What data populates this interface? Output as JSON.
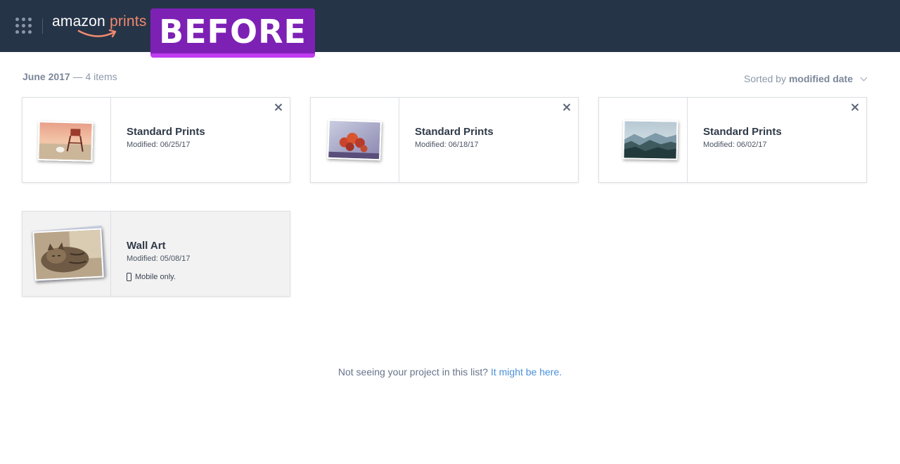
{
  "header": {
    "logo_primary": "amazon",
    "logo_secondary": "prints",
    "badge": "BEFORE",
    "colors": {
      "bar": "#263448",
      "logo_accent": "#f08a6e",
      "badge": "#7d21b5"
    }
  },
  "group": {
    "date": "June 2017",
    "count": "— 4 items"
  },
  "sort": {
    "prefix": "Sorted by",
    "value": "modified date"
  },
  "projects": [
    {
      "title": "Standard Prints",
      "modified": "Modified: 06/25/17",
      "thumbnail": "beach-lifeguard-photo"
    },
    {
      "title": "Standard Prints",
      "modified": "Modified: 06/18/17",
      "thumbnail": "red-flowers-photo"
    },
    {
      "title": "Standard Prints",
      "modified": "Modified: 06/02/17",
      "thumbnail": "misty-mountains-photo"
    },
    {
      "title": "Wall Art",
      "modified": "Modified: 05/08/17",
      "note": "Mobile only.",
      "thumbnail": "sleeping-cat-photo"
    }
  ],
  "footer": {
    "text": "Not seeing your project in this list?",
    "link": "It might be here."
  }
}
